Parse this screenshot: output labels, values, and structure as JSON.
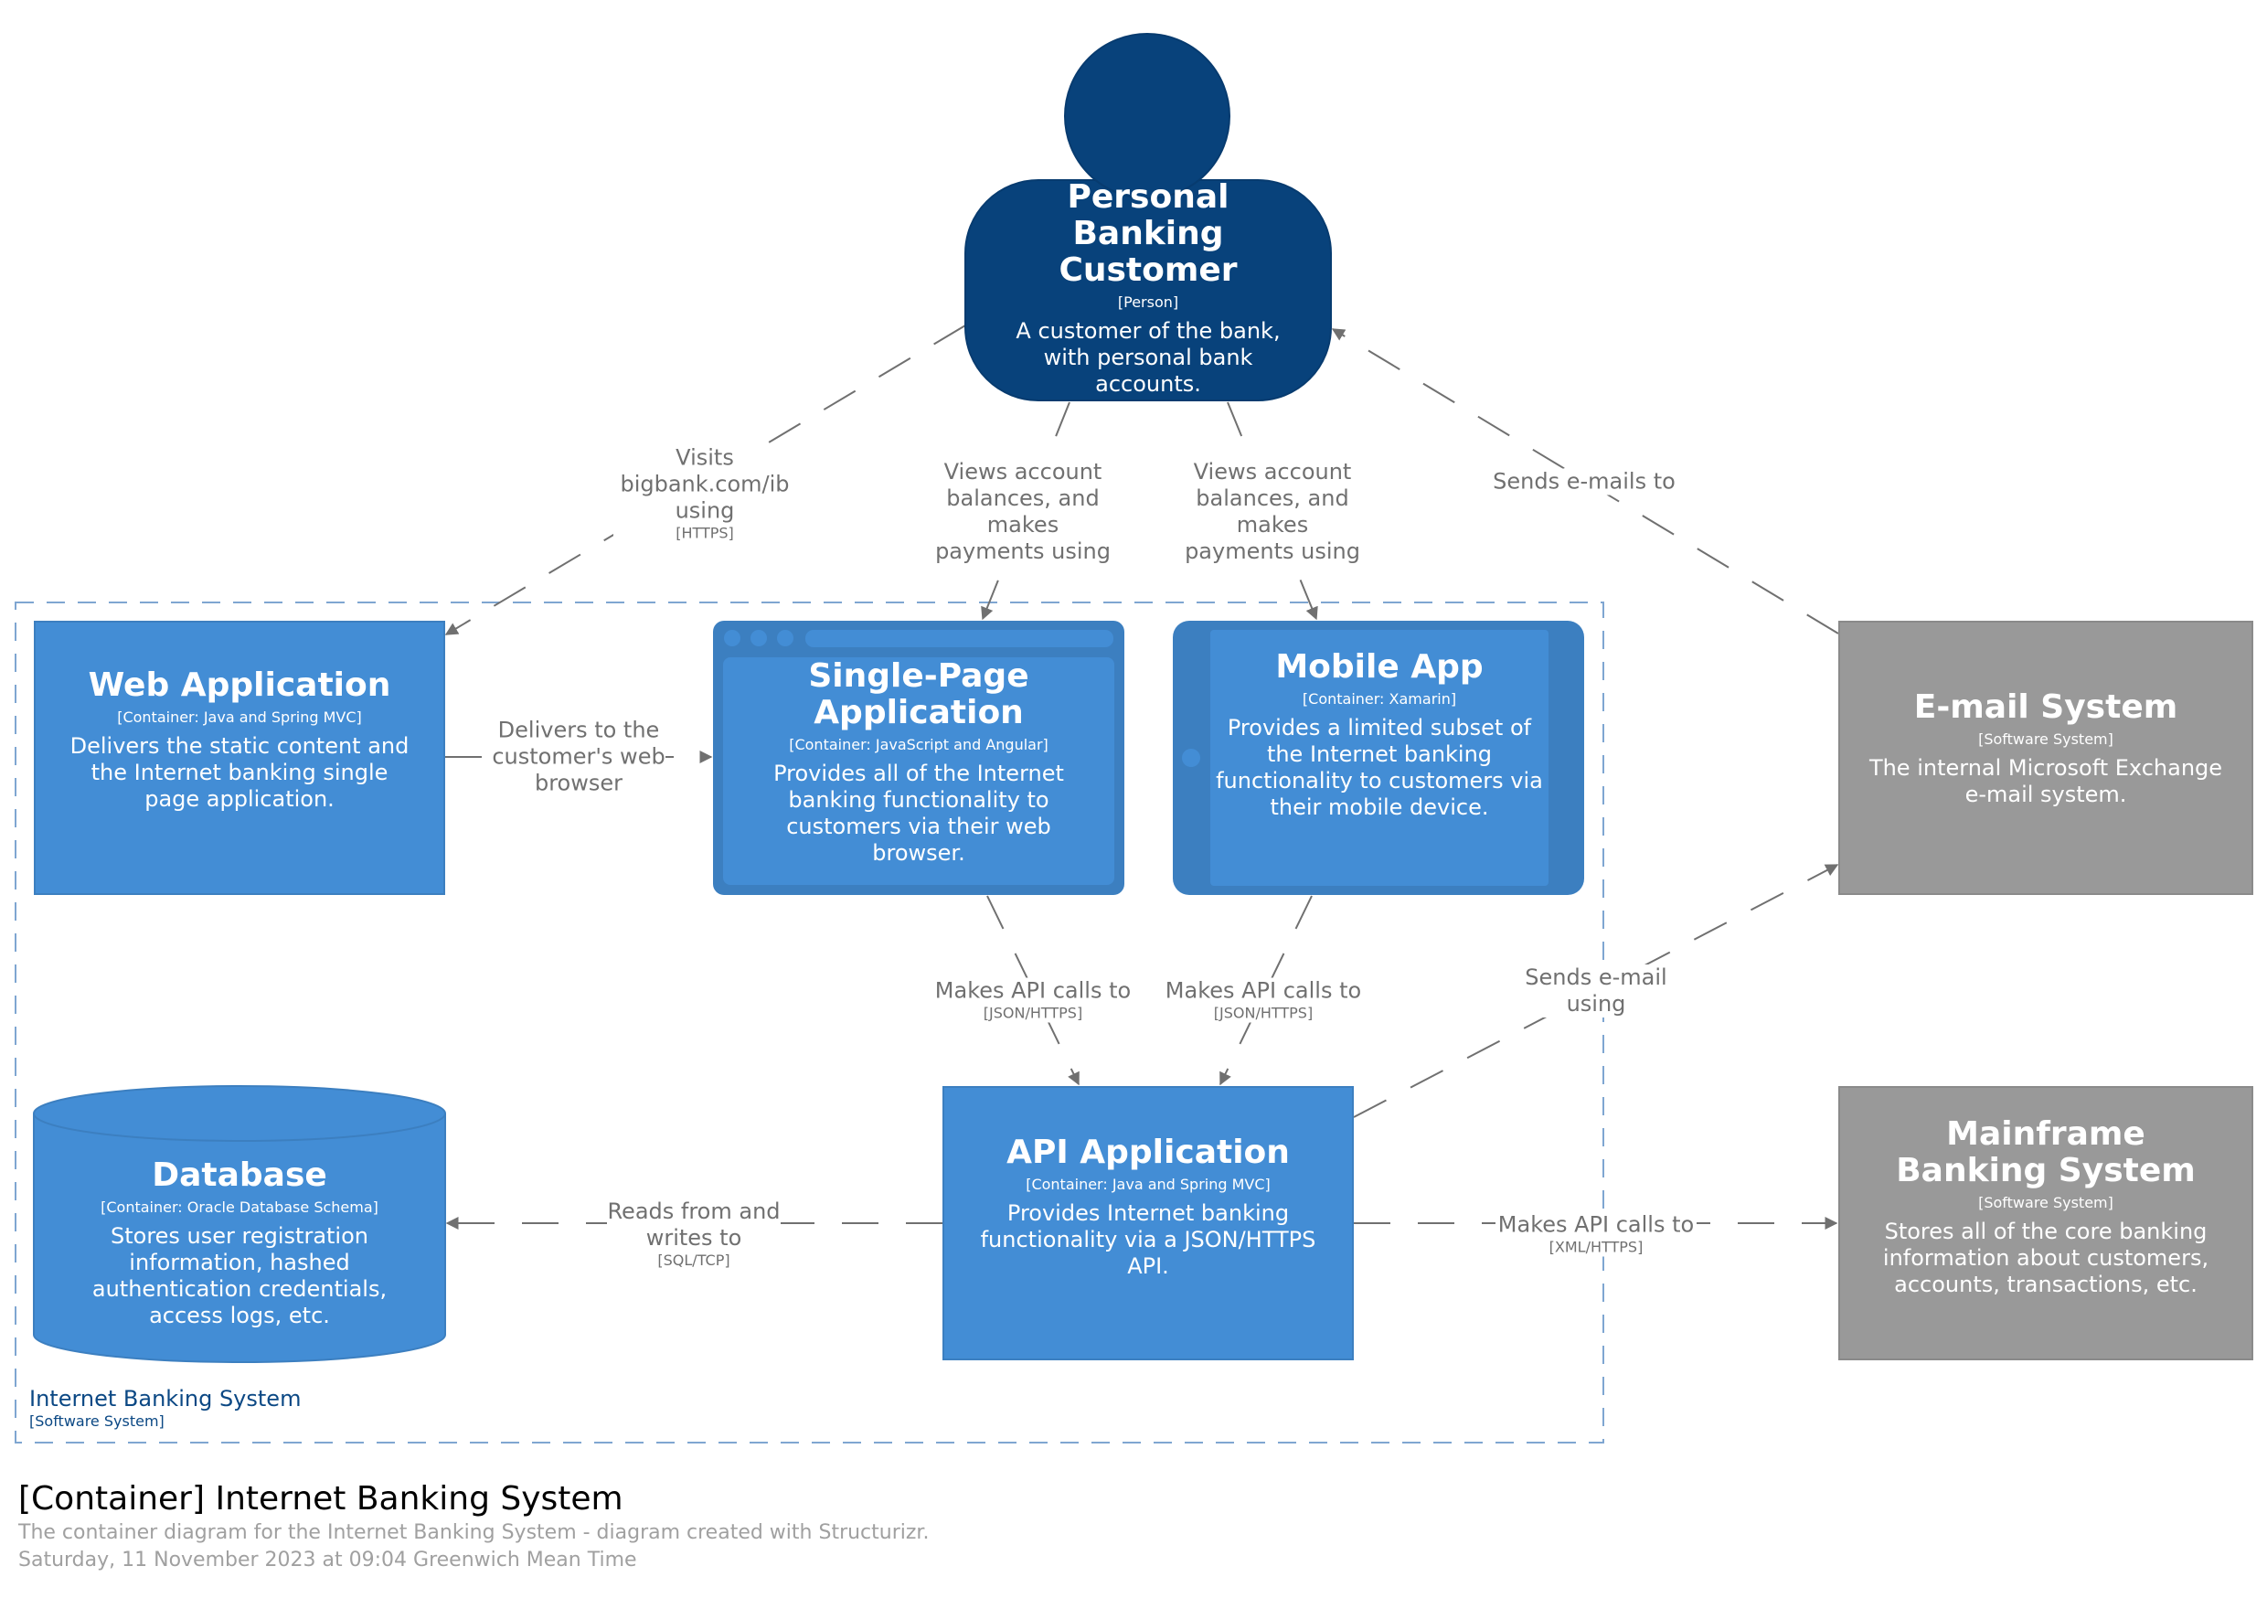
{
  "colors": {
    "person": "#08427b",
    "container": "#438dd5",
    "container_dark": "#3c7fc0",
    "external": "#999999",
    "boundary": "#7fa6d1",
    "relationship": "#707070"
  },
  "person": {
    "name": "Personal Banking Customer",
    "type": "[Person]",
    "description": "A customer of the bank, with personal bank accounts.",
    "icon": "person-icon"
  },
  "boundary": {
    "name": "Internet Banking System",
    "type": "[Software System]"
  },
  "containers": {
    "web_app": {
      "name": "Web Application",
      "type": "[Container: Java and Spring MVC]",
      "description": "Delivers the static content and the Internet banking single page application."
    },
    "spa": {
      "name": "Single-Page Application",
      "type": "[Container: JavaScript and Angular]",
      "description": "Provides all of the Internet banking functionality to customers via their web browser.",
      "icon": "web-browser-shape"
    },
    "mobile_app": {
      "name": "Mobile App",
      "type": "[Container: Xamarin]",
      "description": "Provides a limited subset of the Internet banking functionality to customers via their mobile device.",
      "icon": "mobile-device-shape"
    },
    "database": {
      "name": "Database",
      "type": "[Container: Oracle Database Schema]",
      "description": "Stores user registration information, hashed authentication credentials, access logs, etc.",
      "icon": "cylinder-shape"
    },
    "api_app": {
      "name": "API Application",
      "type": "[Container: Java and Spring MVC]",
      "description": "Provides Internet banking functionality via a JSON/HTTPS API."
    }
  },
  "external_systems": {
    "email": {
      "name": "E-mail System",
      "type": "[Software System]",
      "description": "The internal Microsoft Exchange e-mail system."
    },
    "mainframe": {
      "name": "Mainframe Banking System",
      "type": "[Software System]",
      "description": "Stores all of the core banking information about customers, accounts, transactions, etc."
    }
  },
  "relationships": {
    "visits": {
      "label": "Visits bigbank.com/ib using",
      "tech": "[HTTPS]"
    },
    "views_spa": {
      "label": "Views account balances, and makes payments using",
      "tech": ""
    },
    "views_mobile": {
      "label": "Views account balances, and makes payments using",
      "tech": ""
    },
    "sends_emails": {
      "label": "Sends e-mails to",
      "tech": ""
    },
    "delivers": {
      "label": "Delivers to the customer's web browser",
      "tech": ""
    },
    "spa_api": {
      "label": "Makes API calls to",
      "tech": "[JSON/HTTPS]"
    },
    "mobile_api": {
      "label": "Makes API calls to",
      "tech": "[JSON/HTTPS]"
    },
    "sends_email_using": {
      "label": "Sends e-mail using",
      "tech": ""
    },
    "reads_writes": {
      "label": "Reads from and writes to",
      "tech": "[SQL/TCP]"
    },
    "api_mainframe": {
      "label": "Makes API calls to",
      "tech": "[XML/HTTPS]"
    }
  },
  "footer": {
    "title": "[Container] Internet Banking System",
    "description": "The container diagram for the Internet Banking System - diagram created with Structurizr.",
    "timestamp": "Saturday, 11 November 2023 at 09:04 Greenwich Mean Time"
  }
}
